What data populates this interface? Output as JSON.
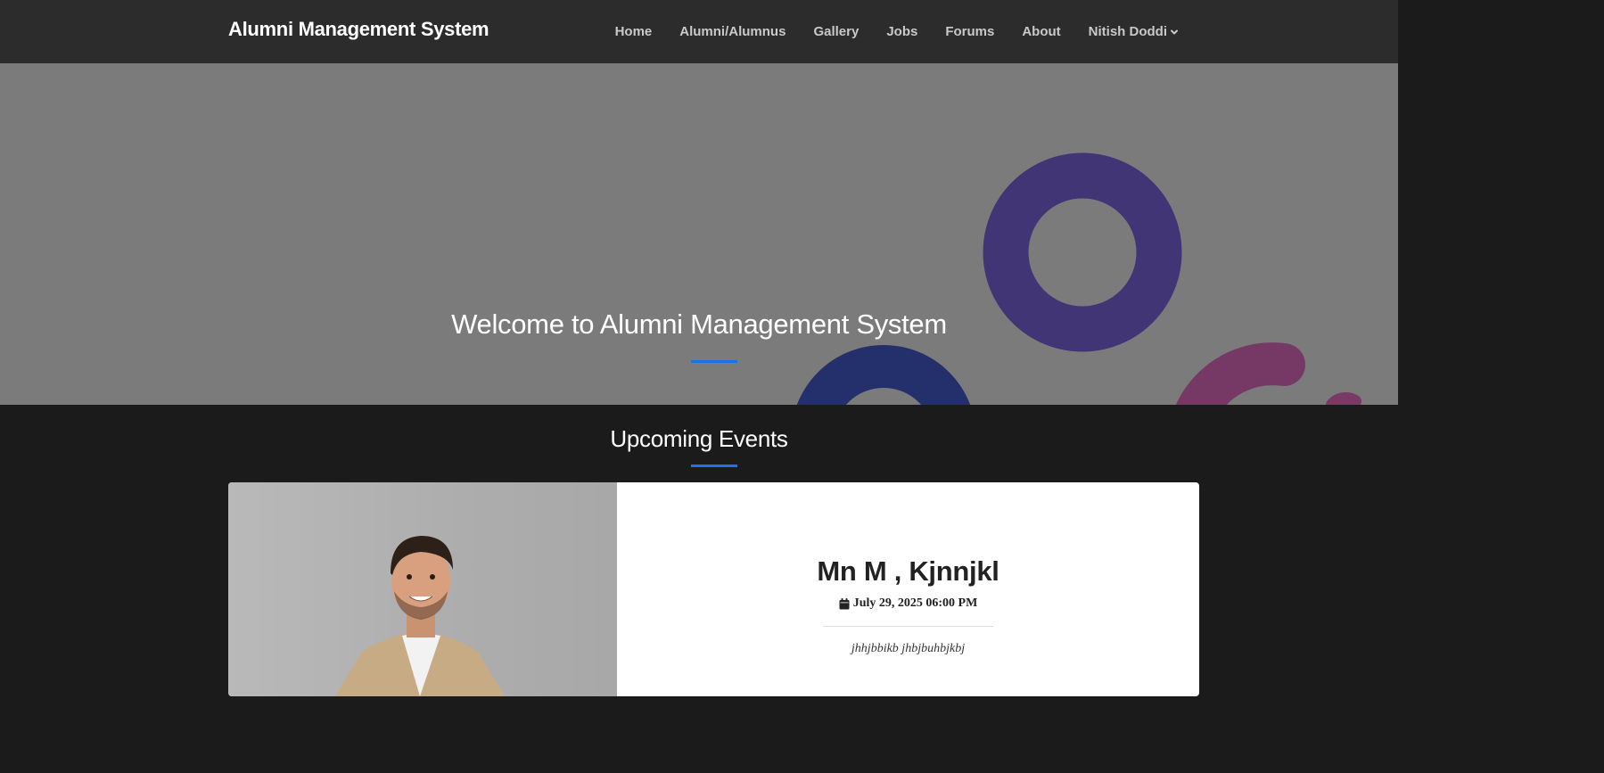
{
  "navbar": {
    "brand": "Alumni Management System",
    "links": [
      "Home",
      "Alumni/Alumnus",
      "Gallery",
      "Jobs",
      "Forums",
      "About"
    ],
    "user_menu": "Nitish Doddi"
  },
  "hero": {
    "title": "Welcome to Alumni Management System"
  },
  "events": {
    "heading": "Upcoming Events",
    "items": [
      {
        "title": "Mn M , Kjnnjkl",
        "date": "July 29, 2025 06:00 PM",
        "description": "jhhjbbikb jhbjbuhbjkbj"
      }
    ]
  },
  "colors": {
    "navbar_bg": "#2c2c2c",
    "hero_bg": "#7b7b7b",
    "page_bg": "#1b1b1b",
    "accent": "#1a73e8"
  }
}
